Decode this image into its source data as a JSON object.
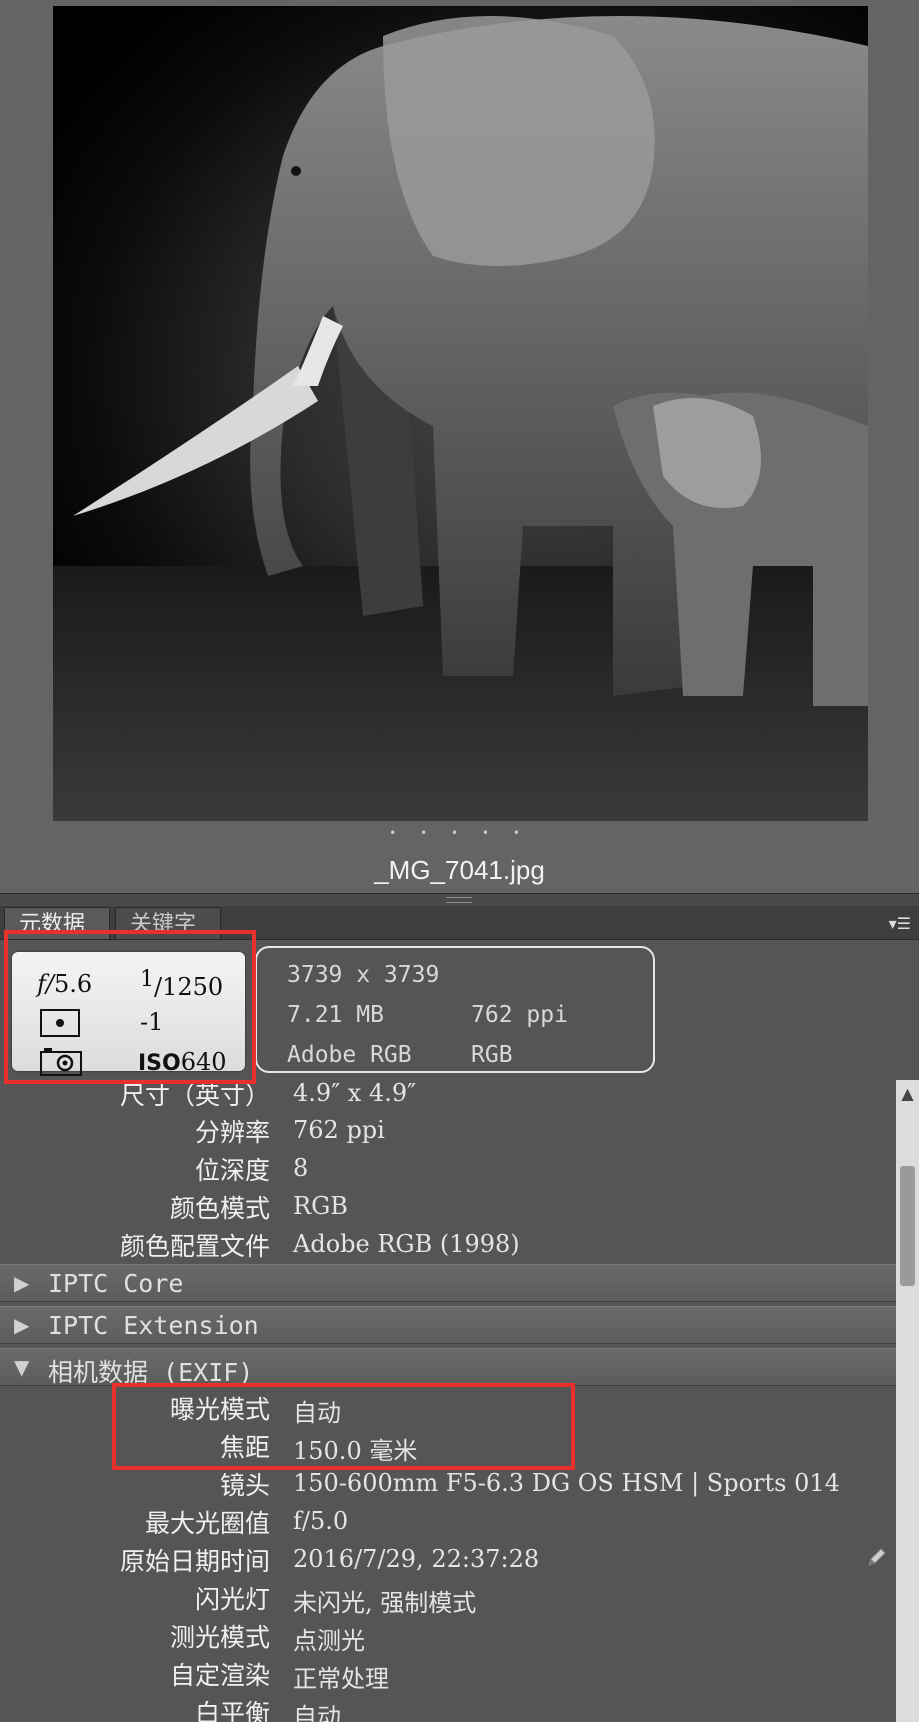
{
  "preview": {
    "dots": "• • • • •",
    "filename": "_MG_7041.jpg"
  },
  "tabs": [
    "元数据",
    "关键字"
  ],
  "camera_summary": {
    "f_prefix": "f/",
    "aperture": "5.6",
    "shutter_num": "1",
    "shutter_den": "1250",
    "exposure_bias": "-1",
    "iso_label": "ISO",
    "iso_value": "640"
  },
  "file_summary": {
    "dimensions": "3739 x 3739",
    "file_size": "7.21 MB",
    "resolution": "762 ppi",
    "color_space": "Adobe RGB",
    "color_mode": "RGB"
  },
  "file_properties": [
    {
      "label": "尺寸（英寸）",
      "value": "4.9″ x 4.9″"
    },
    {
      "label": "分辨率",
      "value": "762 ppi"
    },
    {
      "label": "位深度",
      "value": "8"
    },
    {
      "label": "颜色模式",
      "value": "RGB"
    },
    {
      "label": "颜色配置文件",
      "value": "Adobe RGB (1998)"
    }
  ],
  "sections": {
    "iptc_core": "IPTC Core",
    "iptc_ext": "IPTC Extension",
    "exif": "相机数据 (EXIF)"
  },
  "exif_rows": [
    {
      "label": "曝光模式",
      "value": "自动"
    },
    {
      "label": "焦距",
      "value": "150.0 毫米"
    },
    {
      "label": "镜头",
      "value": "150-600mm F5-6.3 DG OS HSM | Sports 014"
    },
    {
      "label": "最大光圈值",
      "value": "f/5.0"
    },
    {
      "label": "原始日期时间",
      "value": "2016/7/29, 22:37:28"
    },
    {
      "label": "闪光灯",
      "value": "未闪光, 强制模式"
    },
    {
      "label": "测光模式",
      "value": "点测光"
    },
    {
      "label": "自定渲染",
      "value": "正常处理"
    },
    {
      "label": "白平衡",
      "value": "自动"
    }
  ]
}
